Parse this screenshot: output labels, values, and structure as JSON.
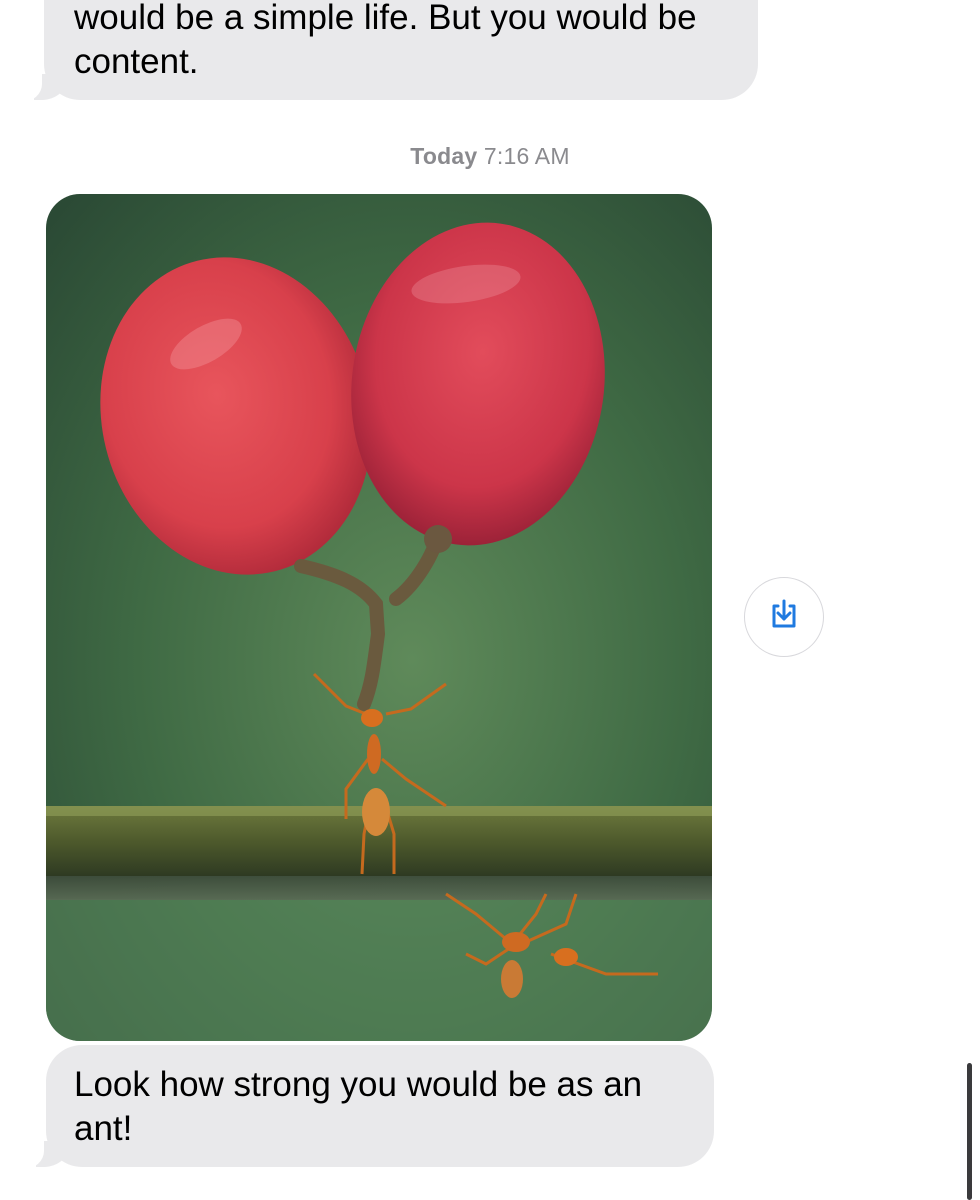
{
  "conversation": {
    "messages": [
      {
        "sender": "them",
        "type": "text",
        "text": "would be a simple life. But you would be content."
      },
      {
        "sender": "them",
        "type": "image",
        "alt": "Ant lifting two red grapes on a twig"
      },
      {
        "sender": "them",
        "type": "text",
        "text": "Look how strong you would be as an ant!"
      }
    ],
    "timestamp": {
      "day": "Today",
      "time": "7:16 AM"
    }
  },
  "actions": {
    "save_icon": "square-arrow-down-icon"
  },
  "colors": {
    "bubble_gray": "#e9e9eb",
    "timestamp_gray": "#8a8a8e",
    "accent_blue": "#1f7ae0"
  }
}
